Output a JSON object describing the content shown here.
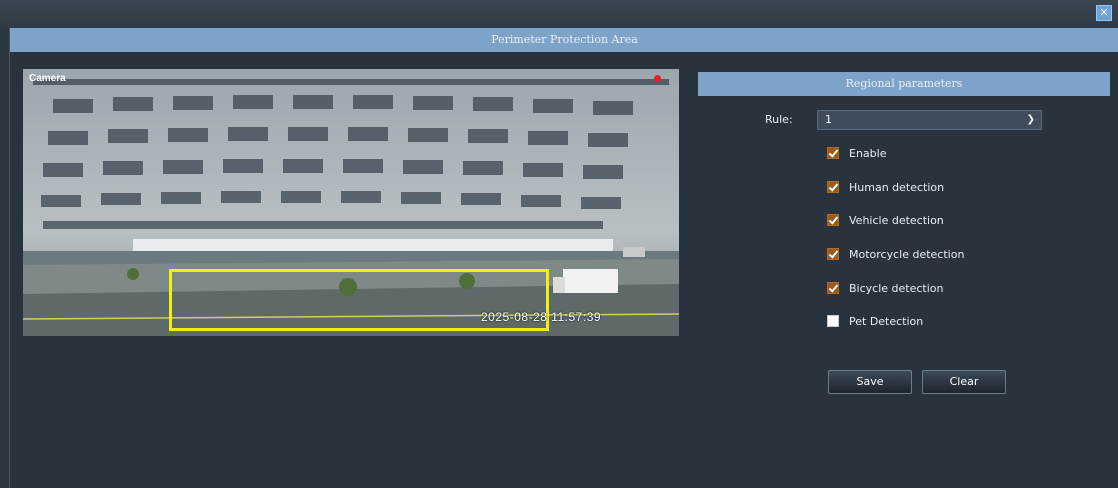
{
  "window": {
    "close_symbol": "✕"
  },
  "panel": {
    "title": "Perimeter Protection Area"
  },
  "camera": {
    "label": "Camera",
    "timestamp": "2025-08-28 11:57:39"
  },
  "params": {
    "title": "Regional parameters",
    "rule_label": "Rule:",
    "rule_value": "1",
    "options": [
      {
        "label": "Enable",
        "checked": true
      },
      {
        "label": "Human detection",
        "checked": true
      },
      {
        "label": "Vehicle detection",
        "checked": true
      },
      {
        "label": "Motorcycle detection",
        "checked": true
      },
      {
        "label": "Bicycle detection",
        "checked": true
      },
      {
        "label": "Pet Detection",
        "checked": false
      }
    ],
    "save_label": "Save",
    "clear_label": "Clear"
  },
  "colors": {
    "header": "#7ea3c9",
    "zone": "#f4ee14",
    "checkbox_on": "#9c5a1c"
  }
}
